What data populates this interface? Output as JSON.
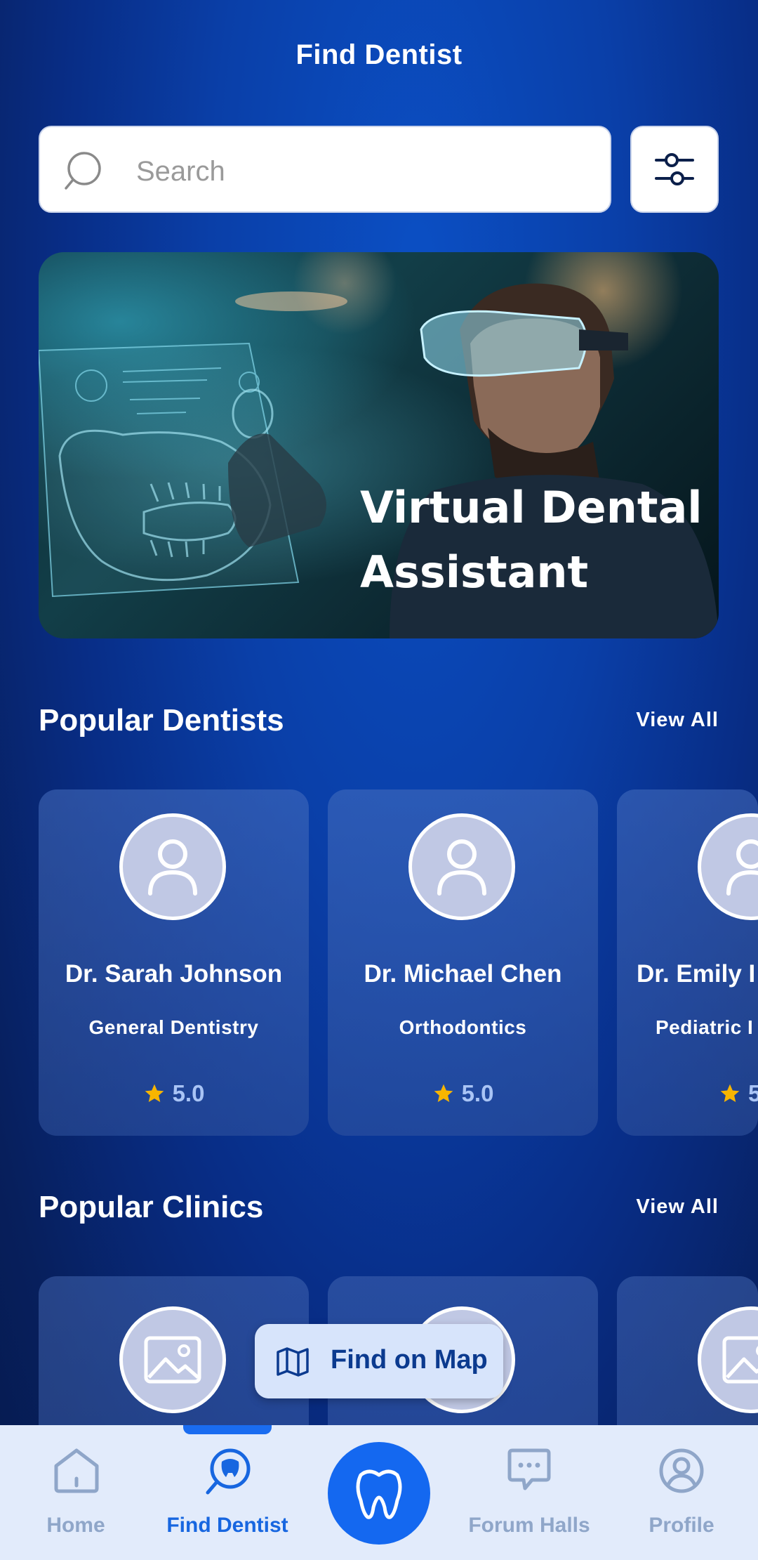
{
  "header": {
    "title": "Find Dentist"
  },
  "search": {
    "placeholder": "Search"
  },
  "banner": {
    "line1": "Virtual Dental",
    "line2": "Assistant"
  },
  "popular_dentists": {
    "title": "Popular Dentists",
    "view_all": "View All",
    "items": [
      {
        "name": "Dr. Sarah Johnson",
        "specialty": "General Dentistry",
        "rating": "5.0"
      },
      {
        "name": "Dr. Michael Chen",
        "specialty": "Orthodontics",
        "rating": "5.0"
      },
      {
        "name": "Dr. Emily I",
        "specialty": "Pediatric I",
        "rating": "5"
      }
    ]
  },
  "popular_clinics": {
    "title": "Popular Clinics",
    "view_all": "View All"
  },
  "map_button": {
    "label": "Find on Map"
  },
  "bottom_nav": {
    "items": [
      {
        "label": "Home",
        "icon": "home-icon"
      },
      {
        "label": "Find Dentist",
        "icon": "find-dentist-icon",
        "active": true
      },
      {
        "label": "",
        "icon": "tooth-icon"
      },
      {
        "label": "Forum Halls",
        "icon": "chat-icon"
      },
      {
        "label": "Profile",
        "icon": "profile-icon"
      }
    ]
  },
  "colors": {
    "accent": "#1468f0",
    "star": "#f7b500",
    "rating_text": "#a9c4f5"
  }
}
